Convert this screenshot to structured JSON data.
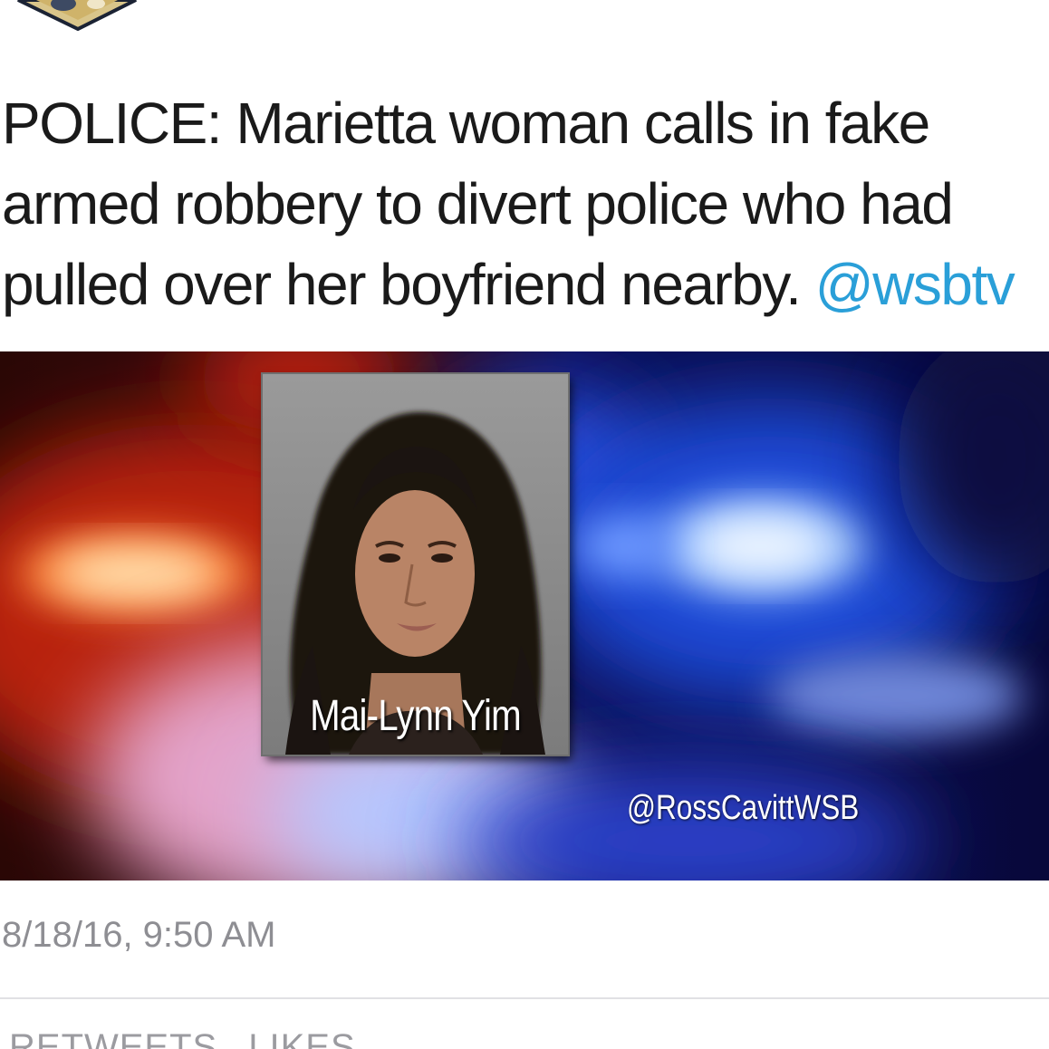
{
  "tweet": {
    "text_lines": [
      "POLICE: Marietta woman calls in fake",
      "armed robbery to divert police who had",
      "pulled over her boyfriend nearby."
    ],
    "mention": "@wsbtv",
    "timestamp": "8/18/16, 9:50 AM"
  },
  "media": {
    "name_caption": "Mai-Lynn Yim",
    "credit": "@RossCavittWSB"
  },
  "stats": {
    "retweets_label": "RETWEETS",
    "likes_label": "LIKES"
  },
  "colors": {
    "mention": "#2a9fd8",
    "text": "#1a1a1a",
    "muted": "#8e8e93"
  },
  "icons": [
    "profile-avatar-image"
  ]
}
